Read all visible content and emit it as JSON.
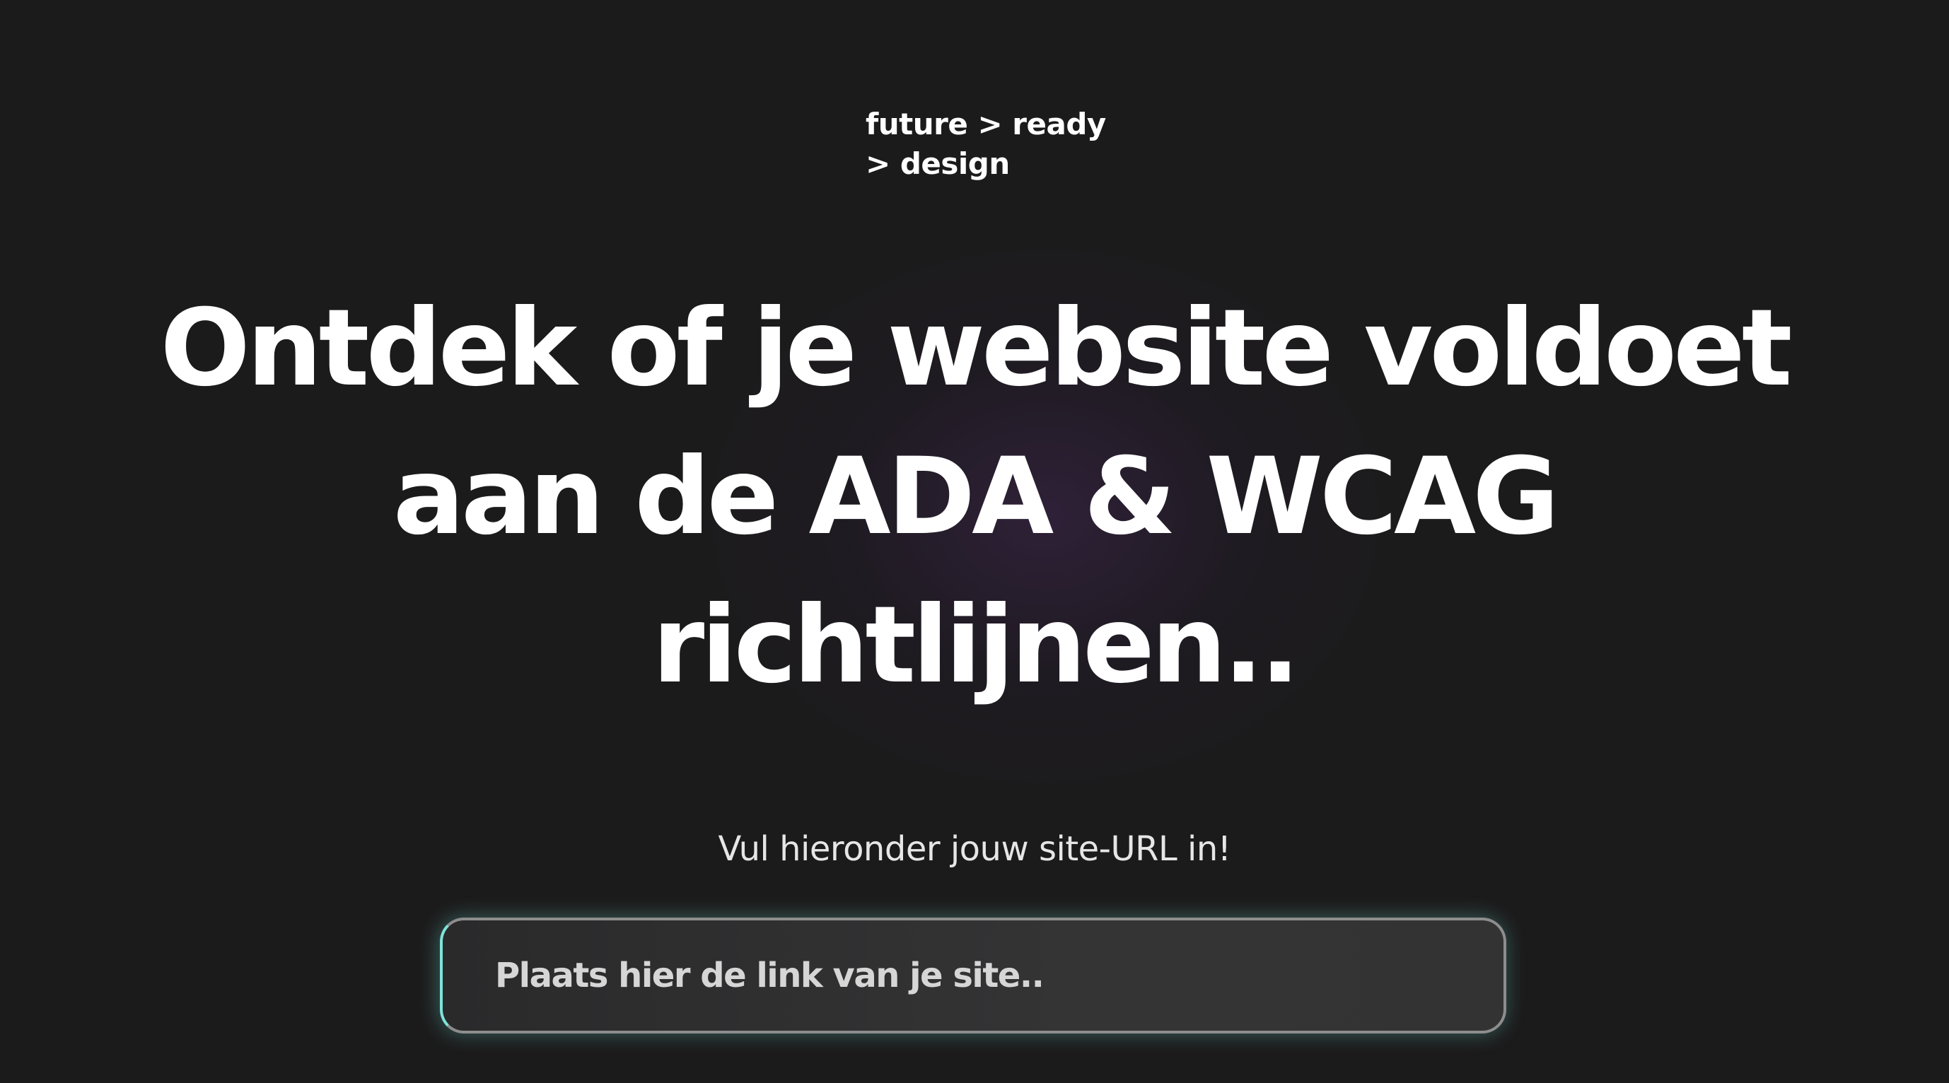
{
  "brand": {
    "logo_line1": "future > ready",
    "logo_line2": "> design"
  },
  "hero": {
    "headline_line1": "Ontdek of je website voldoet",
    "headline_line2": "aan de ADA & WCAG",
    "headline_line3": "richtlijnen.."
  },
  "form": {
    "subtitle": "Vul hieronder jouw site-URL in!",
    "url_input_value": "",
    "url_input_placeholder": "Plaats hier de link van je site.."
  },
  "colors": {
    "background": "#1c1b1c",
    "text": "#ffffff",
    "input_accent": "#7fe3da",
    "input_border": "#8d8d8d"
  }
}
